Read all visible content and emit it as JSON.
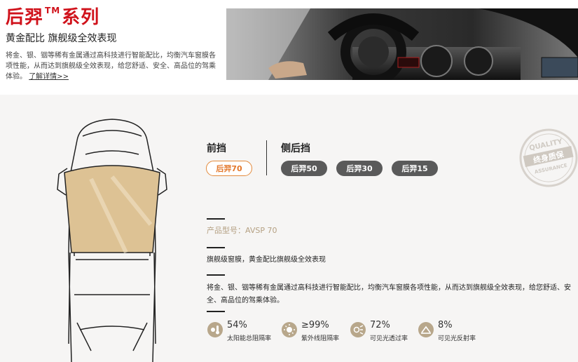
{
  "header": {
    "title_main": "后羿",
    "title_tm": "TM",
    "title_suffix": "系列",
    "subtitle": "黄金配比 旗舰级全效表现",
    "intro": "将金、银、铟等稀有金属通过高科技进行智能配比，均衡汽车窗膜各项性能，从而达到旗舰级全效表现，给您舒适、安全、高品位的驾乘体验。",
    "more_link": "了解详情>>"
  },
  "tabs": {
    "front": "前挡",
    "side_rear": "侧后挡"
  },
  "products": {
    "front_selected": "后羿70",
    "side": [
      "后羿50",
      "后羿30",
      "后羿15"
    ]
  },
  "badge": {
    "top_text": "QUALITY",
    "main_text": "终身质保",
    "bottom_text": "ASSURANCE"
  },
  "detail": {
    "model": "产品型号：AVSP 70",
    "tagline": "旗舰级窗膜，黄金配比旗舰级全效表现",
    "description": "将金、银、铟等稀有金属通过高科技进行智能配比，均衡汽车窗膜各项性能，从而达到旗舰级全效表现，给您舒适、安全、高品位的驾乘体验。"
  },
  "stats": [
    {
      "value": "54%",
      "label": "太阳能总阻隔率",
      "icon": "sun-thermometer-icon"
    },
    {
      "value": "≥99%",
      "label": "紫外线阻隔率",
      "icon": "uv-sun-icon"
    },
    {
      "value": "72%",
      "label": "可见光透过率",
      "icon": "visible-light-icon"
    },
    {
      "value": "8%",
      "label": "可见光反射率",
      "icon": "reflection-icon"
    }
  ],
  "colors": {
    "brand_red": "#d0121b",
    "accent_orange": "#e3782c",
    "gold": "#b8a78b",
    "dark_pill": "#5a5a5a"
  }
}
